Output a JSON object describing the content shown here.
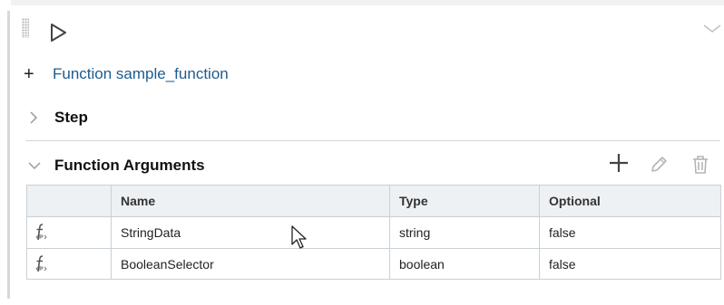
{
  "function_header": {
    "add_symbol": "+",
    "title": "Function sample_function"
  },
  "step_section": {
    "label": "Step",
    "state": "collapsed"
  },
  "arguments_section": {
    "label": "Function Arguments",
    "state": "expanded",
    "toolbar": {
      "add_icon": "plus-icon",
      "edit_icon": "pencil-icon",
      "delete_icon": "trash-icon"
    },
    "table": {
      "columns": [
        "",
        "Name",
        "Type",
        "Optional"
      ],
      "rows": [
        {
          "icon": "function-parameter-icon",
          "name": "StringData",
          "type": "string",
          "optional": "false"
        },
        {
          "icon": "function-parameter-icon",
          "name": "BooleanSelector",
          "type": "boolean",
          "optional": "false"
        }
      ]
    }
  },
  "colors": {
    "link": "#1f5b8e",
    "header_bg": "#eef1f4",
    "border": "#c9d0d6",
    "icon_gray": "#8a8a8a"
  }
}
